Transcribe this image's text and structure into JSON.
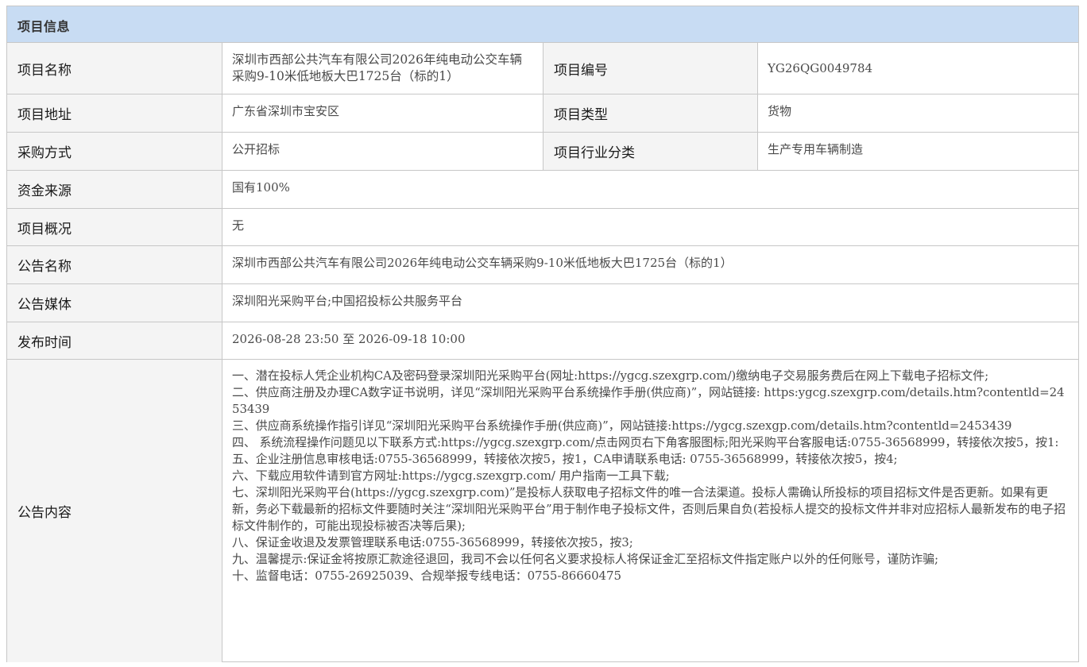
{
  "section_title": "项目信息",
  "fields": {
    "project_name_label": "项目名称",
    "project_name_value": "深圳市西部公共汽车有限公司2026年纯电动公交车辆采购9-10米低地板大巴1725台（标的1）",
    "project_no_label": "项目编号",
    "project_no_value": "YG26QG0049784",
    "project_address_label": "项目地址",
    "project_address_value": "广东省深圳市宝安区",
    "project_type_label": "项目类型",
    "project_type_value": "货物",
    "procurement_method_label": "采购方式",
    "procurement_method_value": "公开招标",
    "industry_label": "项目行业分类",
    "industry_value": "生产专用车辆制造",
    "fund_source_label": "资金来源",
    "fund_source_value": "国有100%",
    "overview_label": "项目概况",
    "overview_value": "无",
    "notice_name_label": "公告名称",
    "notice_name_value": "深圳市西部公共汽车有限公司2026年纯电动公交车辆采购9-10米低地板大巴1725台（标的1）",
    "notice_media_label": "公告媒体",
    "notice_media_value": "深圳阳光采购平台;中国招投标公共服务平台",
    "publish_time_label": "发布时间",
    "publish_time_value": "2026-08-28 23:50 至 2026-09-18 10:00",
    "notice_content_label": "公告内容"
  },
  "notice_content": [
    "一、潜在投标人凭企业机构CA及密码登录深圳阳光采购平台(网址:https://ygcg.szexgrp.com/)缴纳电子交易服务费后在网上下载电子招标文件;",
    "二、供应商注册及办理CA数字证书说明，详见“深圳阳光采购平台系统操作手册(供应商)”，网站链接: https:ygcg.szexgrp.com/details.htm?contentld=2453439",
    "三、供应商系统操作指引详见“深圳阳光采购平台系统操作手册(供应商)”，网站链接:https://ygcg.szexgp.com/details.htm?contentld=2453439",
    "四、 系统流程操作问题见以下联系方式:https://ygcg.szexgrp.com/点击网页右下角客服图标;阳光采购平台客服电话:0755-36568999，转接依次按5，按1:",
    "五、企业注册信息审核电话:0755-36568999，转接依次按5，按1，CA申请联系电话: 0755-36568999，转接依次按5，按4;",
    "六、下载应用软件请到官方网址:https://ygcg.szexgrp.com/ 用户指南一工具下载;",
    "七、深圳阳光采购平台(https://ygcg.szexgrp.com)”是投标人获取电子招标文件的唯一合法渠道。投标人需确认所投标的项目招标文件是否更新。如果有更新，务必下载最新的招标文件要随时关注“深圳阳光采购平台”用于制作电子投标文件，否则后果自负(若投标人提交的投标文件并非对应招标人最新发布的电子招标文件制作的，可能出现投标被否决等后果);",
    "八、保证金收退及发票管理联系电话:0755-36568999，转接依次按5，按3;",
    "九、温馨提示:保证金将按原汇款途径退回，我司不会以任何名义要求投标人将保证金汇至招标文件指定账户以外的任何账号，谨防诈骗;",
    "十、监督电话：0755-26925039、合规举报专线电话：0755-86660475"
  ]
}
